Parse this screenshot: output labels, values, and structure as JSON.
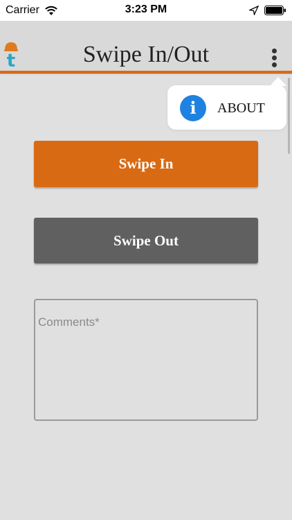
{
  "status_bar": {
    "carrier": "Carrier",
    "time": "3:23 PM",
    "wifi_icon": "wifi-icon",
    "location_icon": "location-arrow-icon",
    "battery_icon": "battery-full-icon"
  },
  "header": {
    "title": "Swipe In/Out",
    "logo_letter": "t",
    "accent_color": "#d96a1a"
  },
  "menu": {
    "icon": "more-vertical-icon",
    "popover": {
      "item_icon": "info-icon",
      "info_glyph": "i",
      "item_label": "ABOUT"
    }
  },
  "main": {
    "swipe_in_label": "Swipe In",
    "swipe_out_label": "Swipe Out",
    "comments_placeholder": "Comments*"
  },
  "colors": {
    "swipe_in": "#d96a14",
    "swipe_out": "#606060",
    "info": "#1f82e0",
    "background": "#e0e0e0"
  }
}
